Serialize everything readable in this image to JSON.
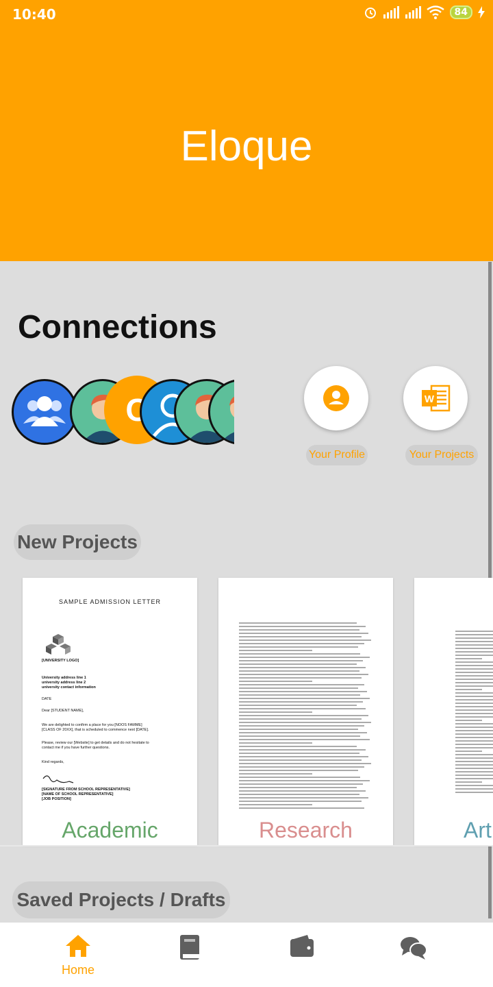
{
  "status_bar": {
    "time": "10:40",
    "battery": "84"
  },
  "header": {
    "title": "Eloque"
  },
  "connections": {
    "title": "Connections",
    "avatars": [
      "group-avatar",
      "person-avatar",
      "letter-avatar",
      "user-avatar",
      "person-avatar",
      "person-avatar"
    ],
    "letter": "C",
    "actions": [
      {
        "label": "Your Profile",
        "icon": "profile-icon"
      },
      {
        "label": "Your  Projects",
        "icon": "word-document-icon"
      }
    ]
  },
  "new_projects": {
    "title": "New Projects",
    "cards": [
      {
        "label": "Academic",
        "color": "#66a66a",
        "doc_heading": "SAMPLE ADMISSION LETTER",
        "doc_lines": [
          "[UNIVERSITY LOGO]",
          "University address line 1",
          "university address line 2",
          "university contact information",
          "DATE",
          "Dear [STUDENT NAME],",
          "We are delighted to confirm a place for you [NOOS FAMME]",
          "[CLASS OF 20XX], that is scheduled to commence next [DATE].",
          "Please, review our [Website] to get details and do not hesitate to",
          "contact me if you have further questions.",
          "Kind regards,",
          "[SIGNATURE FROM SCHOOL REPRESENTATIVE]",
          "[NAME OF SCHOOL REPRESENTATIVE]",
          "[JOB POSITION]"
        ]
      },
      {
        "label": "Research",
        "color": "#d98e8e"
      },
      {
        "label": "Art",
        "color": "#5f9fb0"
      }
    ]
  },
  "saved_projects": {
    "title": "Saved Projects / Drafts"
  },
  "nav": {
    "items": [
      {
        "label": "Home",
        "icon": "home-icon",
        "active": true
      },
      {
        "label": "",
        "icon": "book-icon"
      },
      {
        "label": "",
        "icon": "wallet-icon"
      },
      {
        "label": "",
        "icon": "chat-icon"
      }
    ]
  },
  "colors": {
    "accent": "#ffa200",
    "background": "#dddddd"
  }
}
